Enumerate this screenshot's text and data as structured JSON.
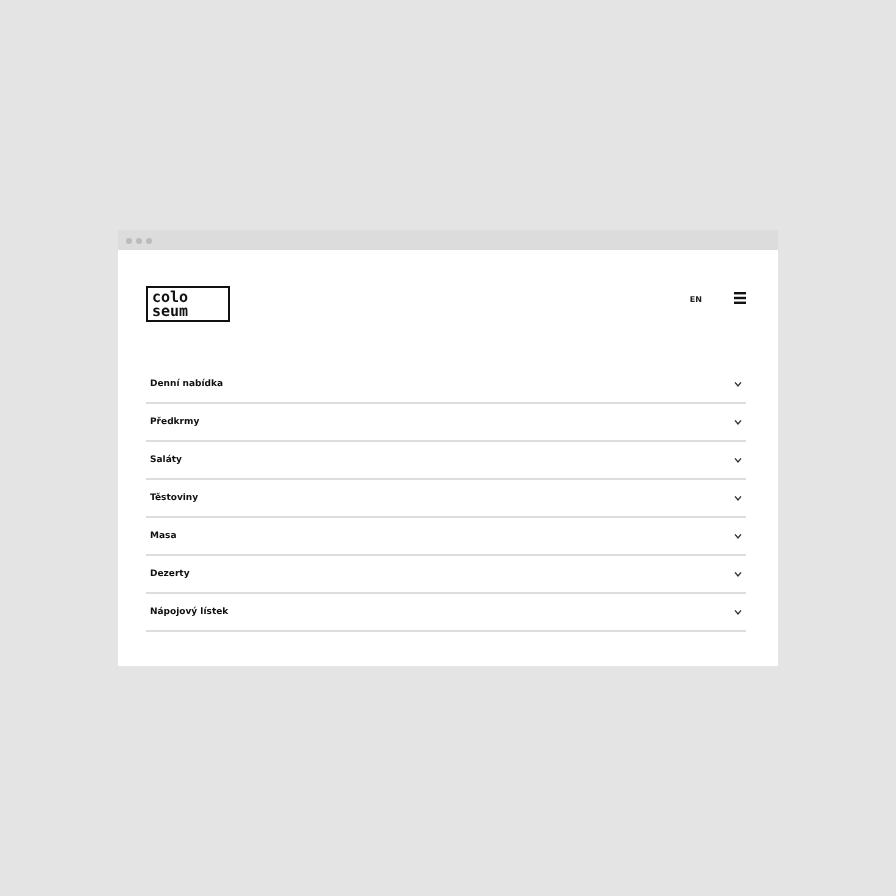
{
  "header": {
    "logo": [
      "colo",
      "seum"
    ],
    "language": "EN"
  },
  "menu_sections": [
    {
      "label": "Denní nabídka",
      "expanded": false
    },
    {
      "label": "Předkrmy",
      "expanded": false
    },
    {
      "label": "Saláty",
      "expanded": false
    },
    {
      "label": "Těstoviny",
      "expanded": false
    },
    {
      "label": "Masa",
      "expanded": false
    },
    {
      "label": "Dezerty",
      "expanded": false
    },
    {
      "label": "Nápojový lístek",
      "expanded": false
    }
  ]
}
